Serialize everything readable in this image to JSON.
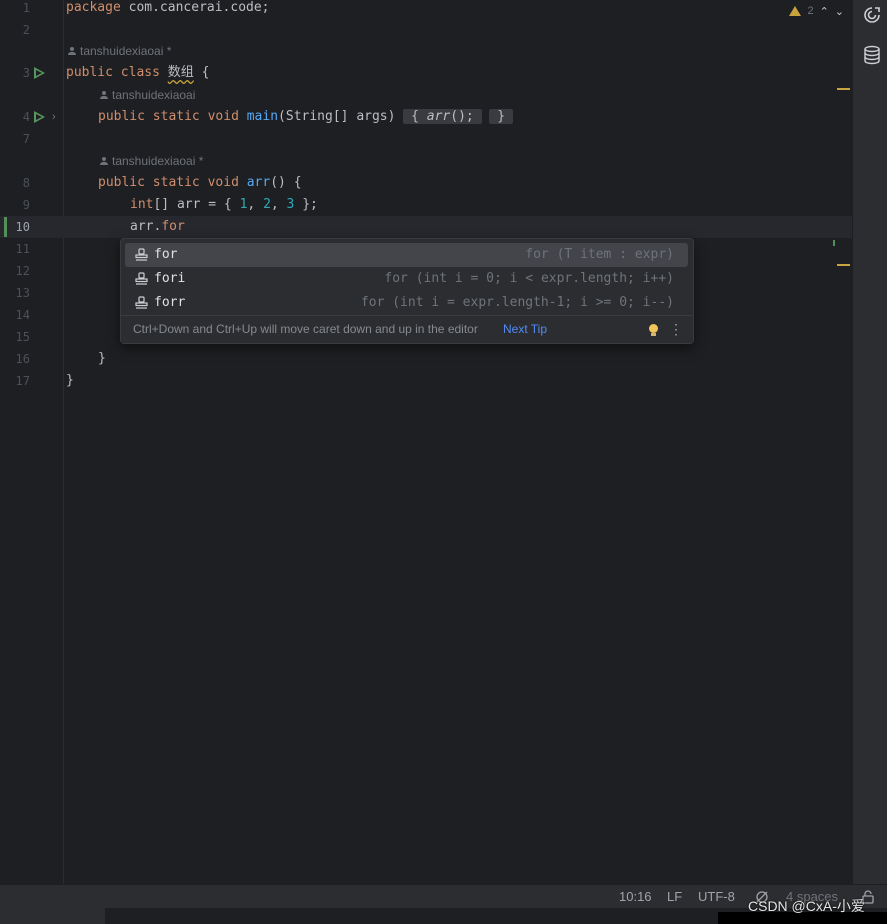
{
  "editor": {
    "lines": [
      {
        "n": "1"
      },
      {
        "n": "2"
      },
      {
        "n": "3"
      },
      {
        "n": "4"
      },
      {
        "n": "7"
      },
      {
        "n": "8"
      },
      {
        "n": "9"
      },
      {
        "n": "10"
      },
      {
        "n": "11"
      },
      {
        "n": "12"
      },
      {
        "n": "13"
      },
      {
        "n": "14"
      },
      {
        "n": "15"
      },
      {
        "n": "16"
      },
      {
        "n": "17"
      }
    ],
    "code": {
      "package": "package",
      "pkg_name": " com.cancerai.code;",
      "public": "public",
      "class": "class",
      "class_name": "数组",
      "brace_open": " {",
      "static": "static",
      "void": "void",
      "main": "main",
      "main_params": "(String[] args)",
      "fold_open": "{",
      "arr_call": "arr",
      "call_tail": "();",
      "fold_close": "}",
      "arr_fn": "arr",
      "arr_params": "() {",
      "int": "int",
      "arr_decl": "[] arr = { ",
      "n1": "1",
      "n2": "2",
      "n3": "3",
      "comma": ", ",
      "decl_end": " };",
      "arr_dot": "arr.",
      "for_kw": "for",
      "close_brace": "}"
    },
    "author_hints": [
      "tanshuidexiaoai *",
      "tanshuidexiaoai",
      "tanshuidexiaoai *"
    ],
    "warnings_count": "2"
  },
  "completion": {
    "items": [
      {
        "name": "for",
        "desc": "for (T item : expr)"
      },
      {
        "name": "fori",
        "desc": "for (int i = 0; i < expr.length; i++)"
      },
      {
        "name": "forr",
        "desc": "for (int i = expr.length-1; i >= 0; i--)"
      }
    ],
    "tip": "Ctrl+Down and Ctrl+Up will move caret down and up in the editor",
    "next_tip": "Next Tip"
  },
  "status": {
    "position": "10:16",
    "line_sep": "LF",
    "encoding": "UTF-8",
    "indent": "4 spaces"
  },
  "watermark": "CSDN @CxA-小爱",
  "colors": {
    "keyword": "#cf8e6d",
    "function": "#56a8f5",
    "number": "#2aacb8",
    "accent": "#548af7"
  }
}
